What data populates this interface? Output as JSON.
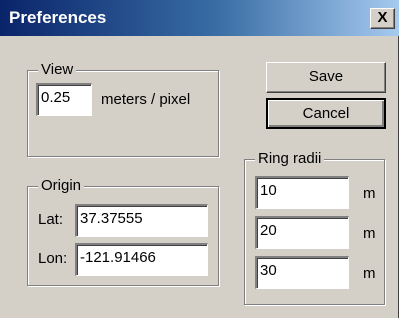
{
  "window": {
    "title": "Preferences",
    "close_glyph": "X"
  },
  "view": {
    "group_label": "View",
    "scale_value": "0.25",
    "scale_unit": "meters / pixel"
  },
  "buttons": {
    "save": "Save",
    "cancel": "Cancel"
  },
  "origin": {
    "group_label": "Origin",
    "lat_label": "Lat:",
    "lat_value": "37.37555",
    "lon_label": "Lon:",
    "lon_value": "-121.91466"
  },
  "ring_radii": {
    "group_label": "Ring radii",
    "items": [
      {
        "value": "10",
        "unit": "m"
      },
      {
        "value": "20",
        "unit": "m"
      },
      {
        "value": "30",
        "unit": "m"
      }
    ]
  }
}
